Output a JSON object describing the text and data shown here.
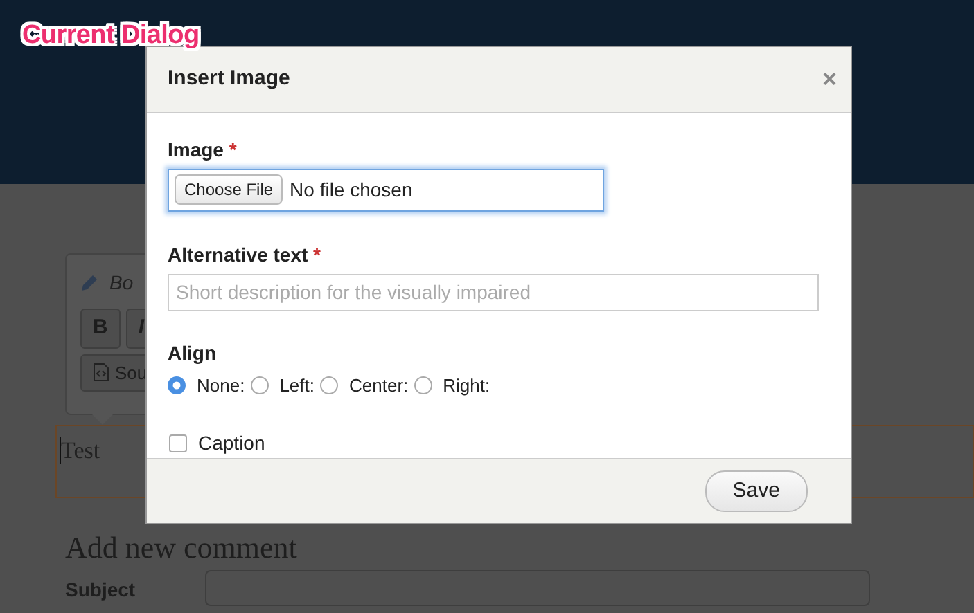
{
  "annotation": "Current Dialog",
  "background_page": {
    "editor_toolbar": {
      "title": "Bo",
      "format_buttons": [
        "B",
        "I"
      ],
      "source_button": "Sou"
    },
    "editor_text": "Test",
    "heading": "Add new comment",
    "subject_label": "Subject"
  },
  "dialog": {
    "title": "Insert Image",
    "close_glyph": "×",
    "image_field": {
      "label": "Image",
      "required_mark": "*",
      "button": "Choose File",
      "status": "No file chosen",
      "focused": true
    },
    "alt_field": {
      "label": "Alternative text",
      "required_mark": "*",
      "placeholder": "Short description for the visually impaired"
    },
    "align": {
      "label": "Align",
      "options": [
        {
          "label": "None:",
          "selected": true
        },
        {
          "label": "Left:",
          "selected": false
        },
        {
          "label": "Center:",
          "selected": false
        },
        {
          "label": "Right:",
          "selected": false
        }
      ]
    },
    "caption": {
      "label": "Caption",
      "checked": false
    },
    "save_button": "Save"
  }
}
